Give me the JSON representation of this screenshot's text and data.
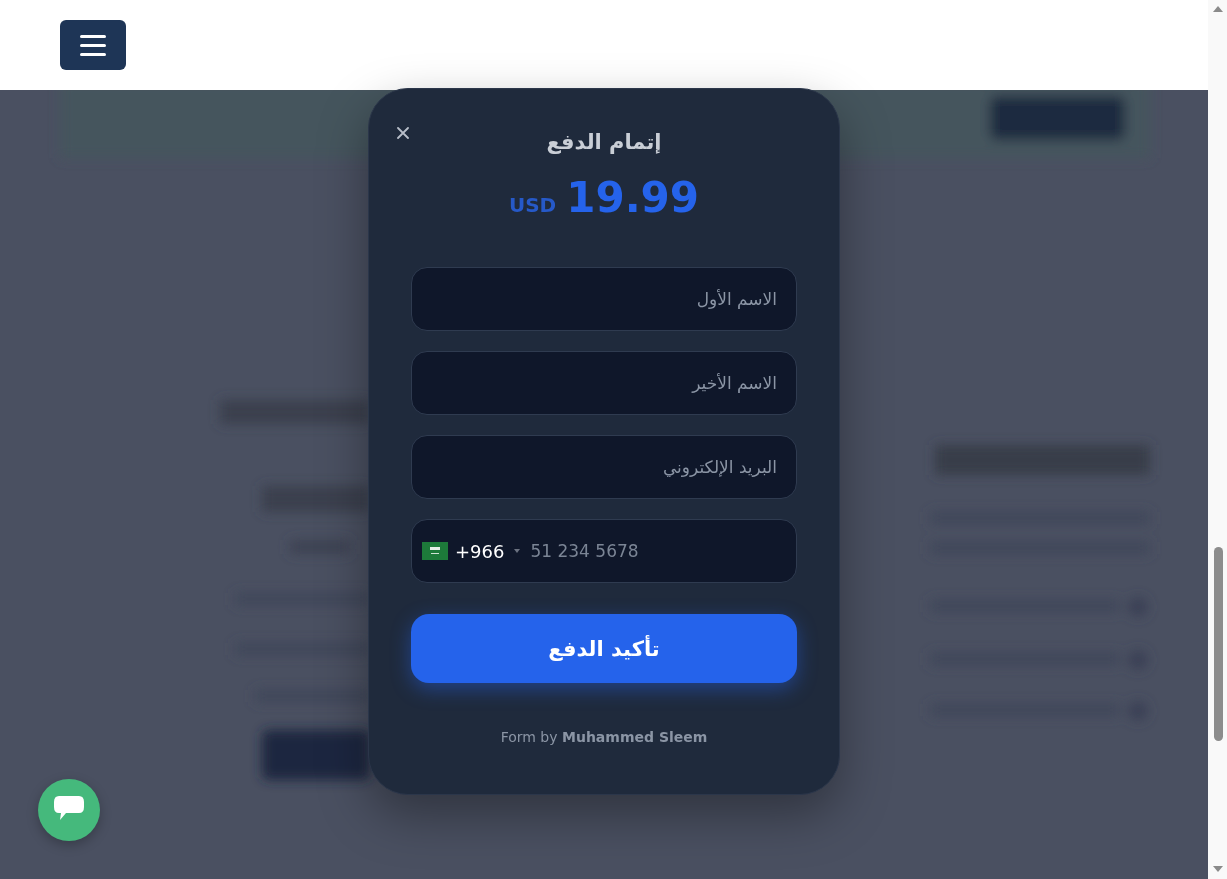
{
  "modal": {
    "title": "إتمام الدفع",
    "price": {
      "currency": "USD",
      "amount": "19.99"
    },
    "fields": [
      {
        "kind": "text",
        "placeholder": "الاسم الأول"
      },
      {
        "kind": "text",
        "placeholder": "الاسم الأخير"
      },
      {
        "kind": "text",
        "placeholder": "البريد الإلكتروني"
      },
      {
        "kind": "phone",
        "dial_code": "+966",
        "placeholder": "51 234 5678"
      }
    ],
    "submit_button": "تأكيد الدفع",
    "footer": "Form by **Muhammed Sleem**"
  }
}
